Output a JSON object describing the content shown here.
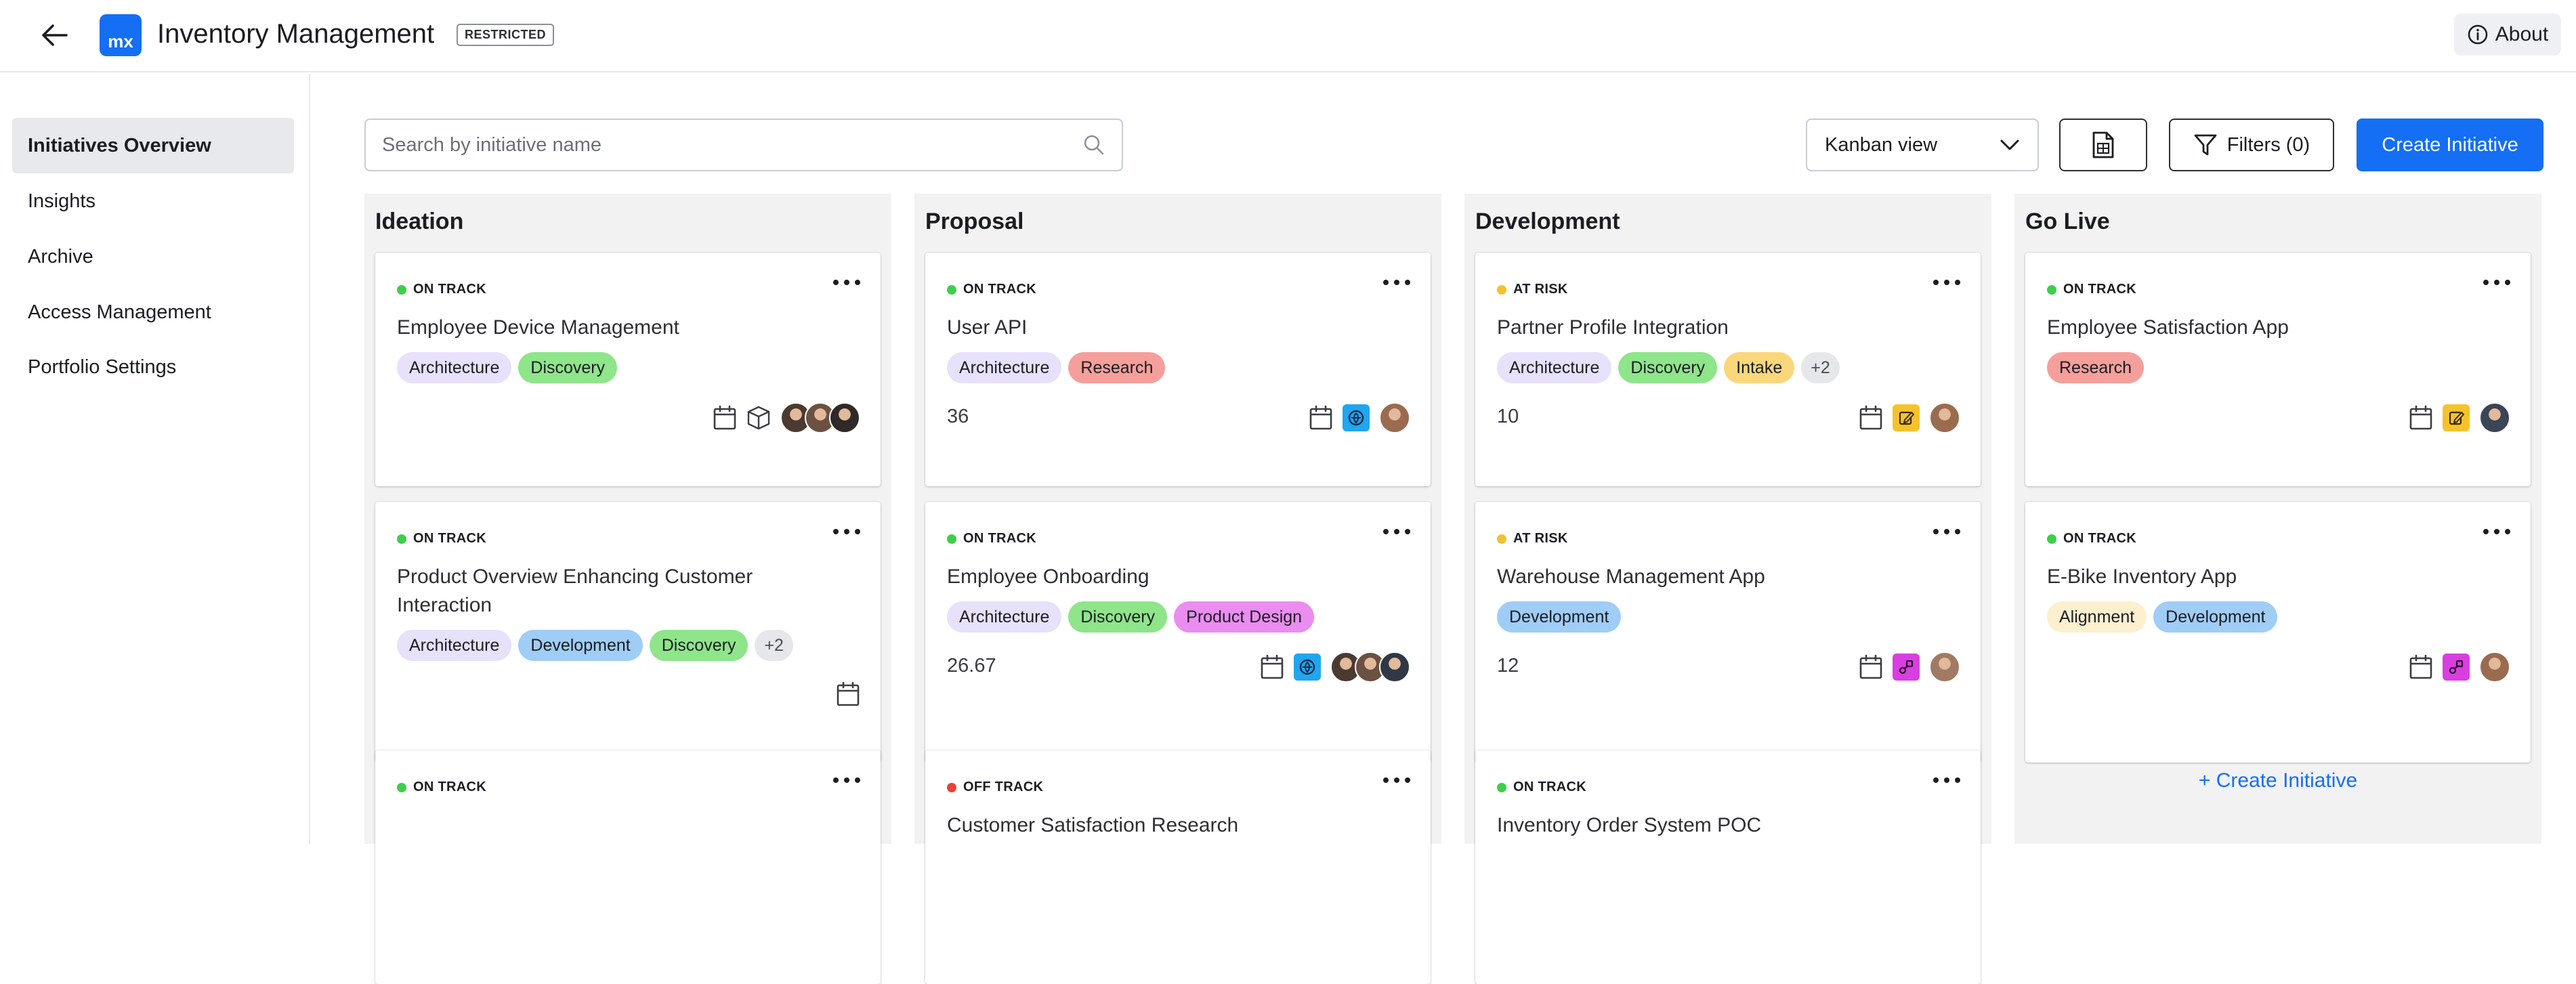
{
  "header": {
    "app_title": "Inventory Management",
    "badge": "RESTRICTED",
    "logo_text": "mx",
    "about_label": "About",
    "back_icon": "arrow-left-icon",
    "brand_color": "#146ff4"
  },
  "sidebar": {
    "items": [
      {
        "label": "Initiatives Overview",
        "active": true
      },
      {
        "label": "Insights",
        "active": false
      },
      {
        "label": "Archive",
        "active": false
      },
      {
        "label": "Access Management",
        "active": false
      },
      {
        "label": "Portfolio Settings",
        "active": false
      }
    ]
  },
  "toolbar": {
    "search_placeholder": "Search by initiative name",
    "view_selected": "Kanban view",
    "filters_label": "Filters (0)",
    "create_label": "Create Initiative"
  },
  "status_colors": {
    "on_track": "#3ecf4a",
    "at_risk": "#f2c12e",
    "off_track": "#e8403a"
  },
  "tag_colors": {
    "Architecture": "#e7e1fb",
    "Discovery": "#8ee58a",
    "Research": "#f59f9b",
    "Intake": "#fbd77b",
    "Development": "#9fcdf6",
    "Product Design": "#ea8cf0",
    "Alignment": "#fdf0cf"
  },
  "columns": [
    {
      "title": "Ideation",
      "cards": [
        {
          "status": "ON TRACK",
          "title": "Employee Device Management",
          "tags": [
            "Architecture",
            "Discovery"
          ],
          "more": "",
          "score": "",
          "icons": [
            "calendar-icon",
            "box-icon"
          ],
          "avatars": [
            "#4a3a32",
            "#6b5142",
            "#2f2a28"
          ]
        },
        {
          "status": "ON TRACK",
          "title": "Product Overview Enhancing Customer Interaction",
          "tags": [
            "Architecture",
            "Development",
            "Discovery"
          ],
          "more": "+2",
          "score": "",
          "icons": [
            "calendar-icon"
          ],
          "avatars": []
        },
        {
          "status": "ON TRACK",
          "title": "",
          "tags": [],
          "more": "",
          "score": "",
          "icons": [],
          "avatars": []
        }
      ]
    },
    {
      "title": "Proposal",
      "cards": [
        {
          "status": "ON TRACK",
          "title": "User API",
          "tags": [
            "Architecture",
            "Research"
          ],
          "more": "",
          "score": "36",
          "icons": [
            "calendar-icon",
            "api-app-icon"
          ],
          "avatars": [
            "#9a6b4f"
          ]
        },
        {
          "status": "ON TRACK",
          "title": "Employee Onboarding",
          "tags": [
            "Architecture",
            "Discovery",
            "Product Design"
          ],
          "more": "",
          "score": "26.67",
          "icons": [
            "calendar-icon",
            "api-app-icon"
          ],
          "avatars": [
            "#4a3a32",
            "#6b5142",
            "#2f3844"
          ]
        },
        {
          "status": "OFF TRACK",
          "title": "Customer Satisfaction Research",
          "tags": [],
          "more": "",
          "score": "",
          "icons": [],
          "avatars": []
        }
      ]
    },
    {
      "title": "Development",
      "cards": [
        {
          "status": "AT RISK",
          "title": "Partner Profile Integration",
          "tags": [
            "Architecture",
            "Discovery",
            "Intake"
          ],
          "more": "+2",
          "score": "10",
          "icons": [
            "calendar-icon",
            "edit-app-icon"
          ],
          "avatars": [
            "#9a6b4f"
          ]
        },
        {
          "status": "AT RISK",
          "title": "Warehouse Management App",
          "tags": [
            "Development"
          ],
          "more": "",
          "score": "12",
          "icons": [
            "calendar-icon",
            "workflow-app-icon"
          ],
          "avatars": [
            "#a07a63"
          ]
        },
        {
          "status": "ON TRACK",
          "title": "Inventory Order System POC",
          "tags": [],
          "more": "",
          "score": "",
          "icons": [],
          "avatars": []
        }
      ]
    },
    {
      "title": "Go Live",
      "cards": [
        {
          "status": "ON TRACK",
          "title": "Employee Satisfaction App",
          "tags": [
            "Research"
          ],
          "more": "",
          "score": "",
          "icons": [
            "calendar-icon",
            "edit-app-icon"
          ],
          "avatars": [
            "#3a4556"
          ]
        },
        {
          "status": "ON TRACK",
          "title": "E-Bike Inventory App",
          "tags": [
            "Alignment",
            "Development"
          ],
          "more": "",
          "score": "",
          "icons": [
            "calendar-icon",
            "workflow-app-icon"
          ],
          "avatars": [
            "#9a6b4f"
          ]
        }
      ],
      "add_label": "+ Create Initiative"
    }
  ]
}
